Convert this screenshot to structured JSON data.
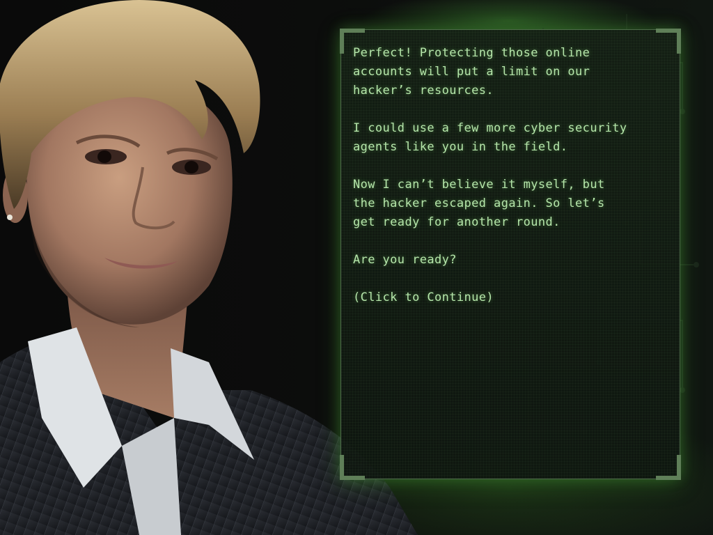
{
  "dialog": {
    "paragraphs": [
      "Perfect! Protecting those online\naccounts will put a limit on our\nhacker’s resources.",
      "I could use a few more cyber security\nagents like you in the field.",
      "Now I can’t believe it myself, but\nthe hacker escaped again. So let’s\nget ready for another round.",
      "Are you ready?"
    ],
    "continue_label": "(Click to Continue)"
  },
  "colors": {
    "text": "#b5e6aa",
    "panel_border": "#4d6a49",
    "glow": "#5ac846"
  }
}
